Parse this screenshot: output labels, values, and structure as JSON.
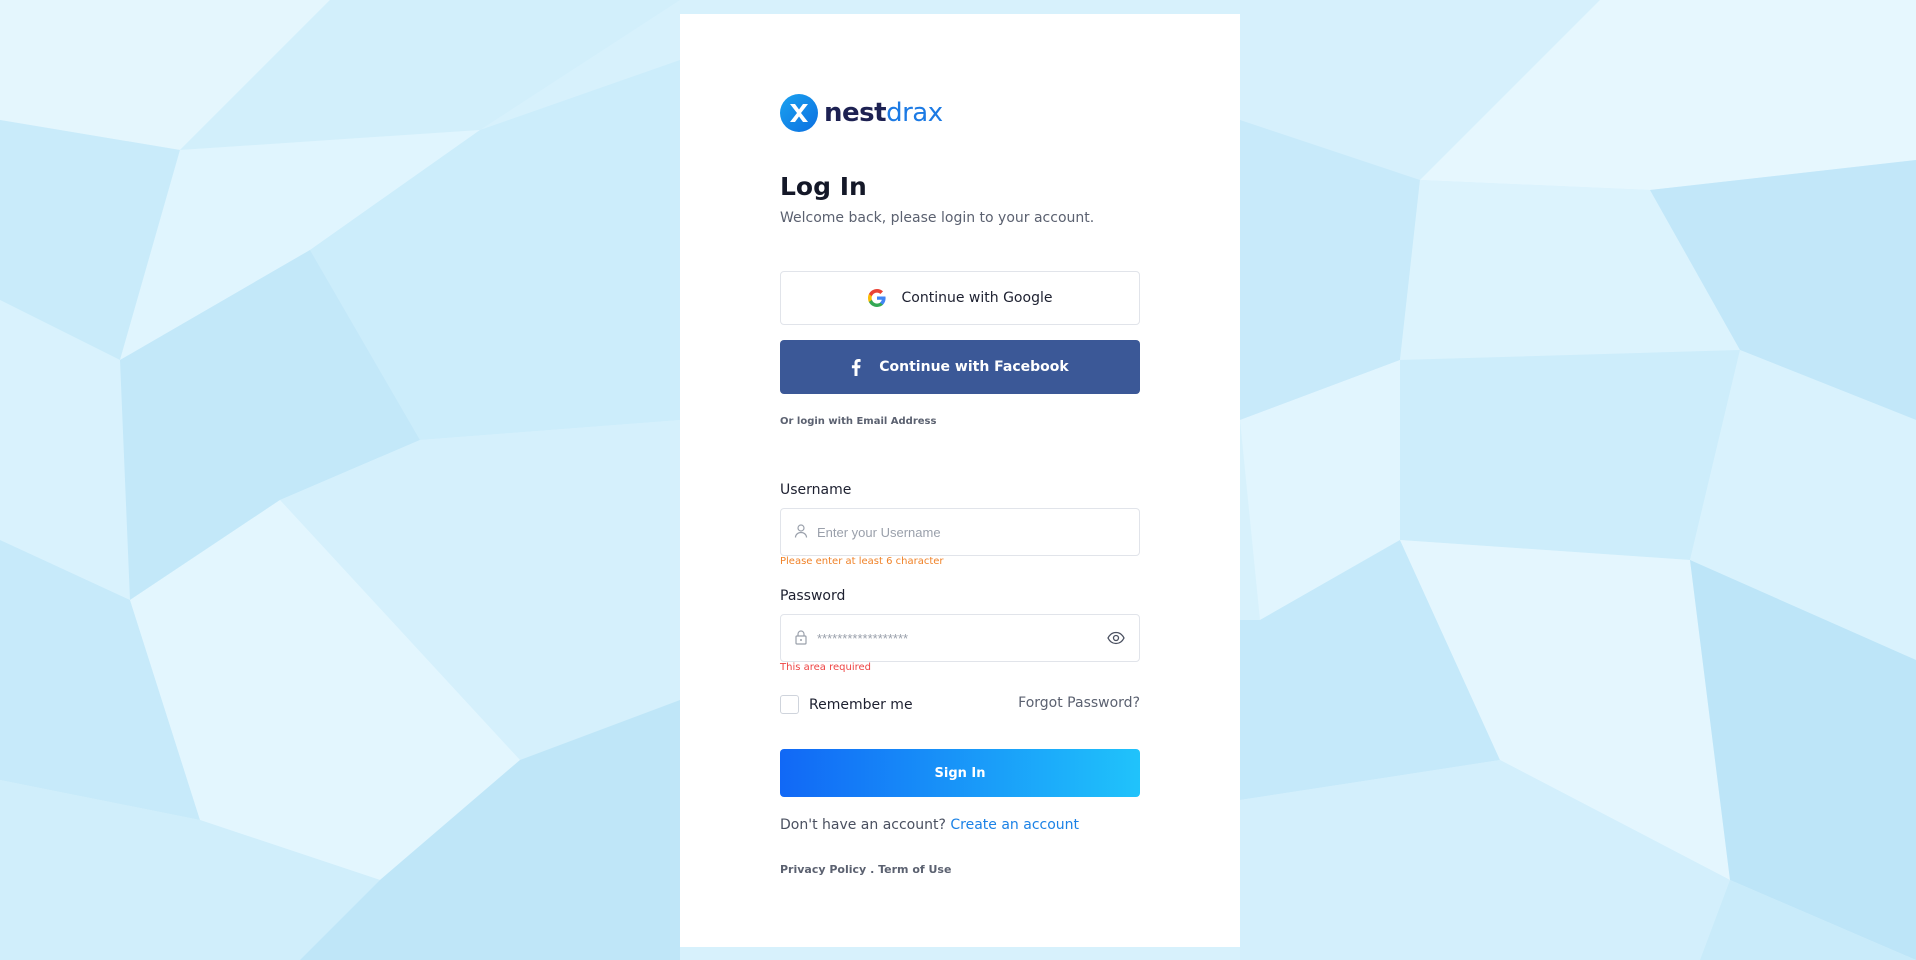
{
  "brand": {
    "name_part1": "nest",
    "name_part2": "drax",
    "primary_color": "#1c7ae4",
    "dark_color": "#1d2152"
  },
  "header": {
    "title": "Log In",
    "subtitle": "Welcome back, please login to your account."
  },
  "social": {
    "google_label": "Continue with Google",
    "facebook_label": "Continue with Facebook",
    "facebook_color": "#3b5897"
  },
  "divider_text": "Or login with Email Address",
  "username": {
    "label": "Username",
    "placeholder": "Enter your Username",
    "value": "",
    "icon": "user-icon",
    "error": "Please enter at least 6 character",
    "error_color": "#f08228"
  },
  "password": {
    "label": "Password",
    "placeholder": "******************",
    "value": "",
    "icon": "lock-icon",
    "toggle_icon": "eye-icon",
    "error": "This area required",
    "error_color": "#ee4444"
  },
  "remember_label": "Remember me",
  "forgot_label": "Forgot Password?",
  "signin_label": "Sign In",
  "signup": {
    "prompt": "Don't have an account?",
    "link": "Create an account"
  },
  "footer": {
    "privacy": "Privacy Policy",
    "separator": ".",
    "terms": "Term of Use"
  }
}
